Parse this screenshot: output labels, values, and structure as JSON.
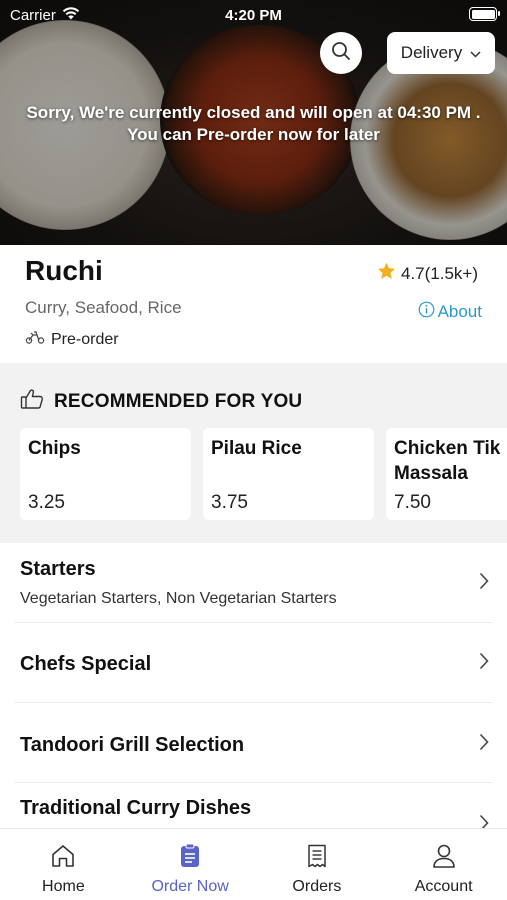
{
  "status_bar": {
    "carrier": "Carrier",
    "time": "4:20 PM"
  },
  "hero": {
    "delivery_label": "Delivery",
    "closed_line1": "Sorry, We're currently closed and will open at 04:30 PM .",
    "closed_line2": "You can Pre-order now for later"
  },
  "restaurant": {
    "name": "Ruchi",
    "cuisines": "Curry, Seafood, Rice",
    "rating": "4.7(1.5k+)",
    "about": "About",
    "preorder": "Pre-order"
  },
  "recommended": {
    "title": "RECOMMENDED FOR YOU",
    "items": [
      {
        "name": "Chips",
        "price": "3.25"
      },
      {
        "name": "Pilau Rice",
        "price": "3.75"
      },
      {
        "name_line1": "Chicken Tik",
        "name_line2": "Massala",
        "price": "7.50"
      }
    ]
  },
  "menu": [
    {
      "title": "Starters",
      "subtitle": "Vegetarian Starters, Non Vegetarian Starters"
    },
    {
      "title": "Chefs Special"
    },
    {
      "title": "Tandoori Grill Selection"
    },
    {
      "title": "Traditional Curry Dishes"
    }
  ],
  "tabs": [
    {
      "label": "Home",
      "icon": "home-icon"
    },
    {
      "label": "Order Now",
      "icon": "order-icon",
      "active": true
    },
    {
      "label": "Orders",
      "icon": "receipt-icon"
    },
    {
      "label": "Account",
      "icon": "account-icon"
    }
  ],
  "colors": {
    "accent": "#5a63c8",
    "link": "#2a9bc8",
    "star": "#f2b01e"
  }
}
